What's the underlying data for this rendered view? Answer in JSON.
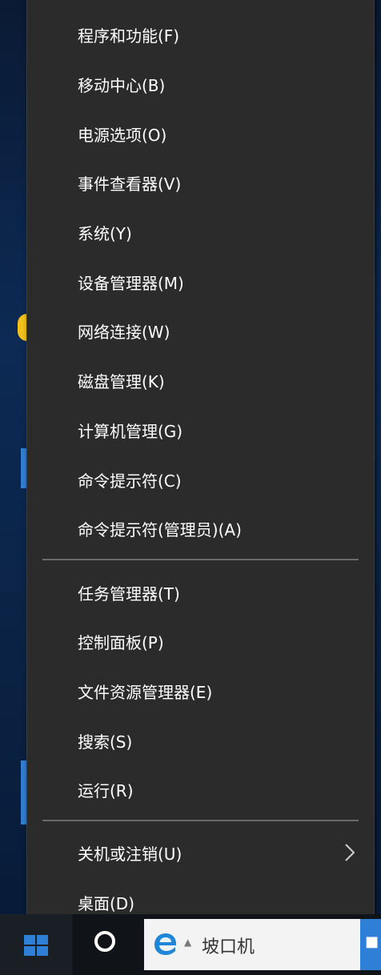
{
  "menu": {
    "groups": [
      {
        "items": [
          {
            "label": "程序和功能(F)"
          },
          {
            "label": "移动中心(B)"
          },
          {
            "label": "电源选项(O)"
          },
          {
            "label": "事件查看器(V)"
          },
          {
            "label": "系统(Y)"
          },
          {
            "label": "设备管理器(M)"
          },
          {
            "label": "网络连接(W)"
          },
          {
            "label": "磁盘管理(K)"
          },
          {
            "label": "计算机管理(G)"
          },
          {
            "label": "命令提示符(C)"
          },
          {
            "label": "命令提示符(管理员)(A)"
          }
        ]
      },
      {
        "items": [
          {
            "label": "任务管理器(T)"
          },
          {
            "label": "控制面板(P)"
          },
          {
            "label": "文件资源管理器(E)"
          },
          {
            "label": "搜索(S)"
          },
          {
            "label": "运行(R)"
          }
        ]
      },
      {
        "items": [
          {
            "label": "关机或注销(U)",
            "has_submenu": true,
            "submenu_icon": "chevron-right-icon"
          },
          {
            "label": "桌面(D)"
          }
        ]
      }
    ]
  },
  "taskbar": {
    "start_icon": "windows-logo-icon",
    "cortana_icon": "cortana-circle-icon",
    "search_app_icon": "edge-icon",
    "search_text": "坡口机"
  },
  "colors": {
    "menu_bg": "#2b2b2b",
    "menu_text": "#ffffff",
    "separator": "#6a6a6a",
    "taskbar_bg": "#101418",
    "accent_blue": "#2f7fd6"
  }
}
